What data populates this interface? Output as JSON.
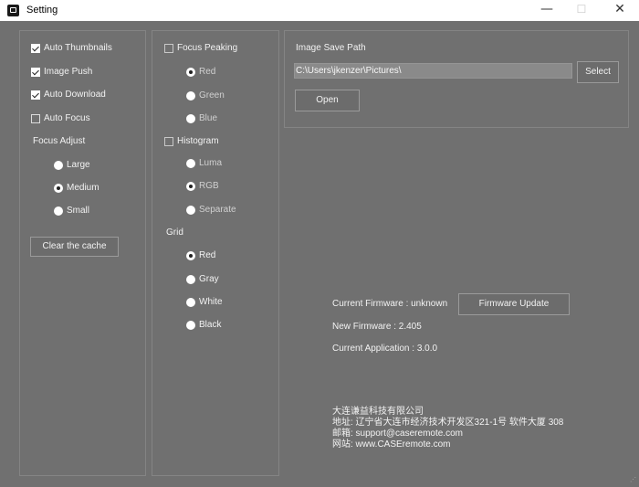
{
  "window": {
    "title": "Setting",
    "minimize_glyph": "—",
    "maximize_glyph": "☐",
    "close_glyph": "✕"
  },
  "left_panel": {
    "options": [
      {
        "label": "Auto Thumbnails",
        "checked": true
      },
      {
        "label": "Image Push",
        "checked": true
      },
      {
        "label": "Auto Download",
        "checked": true
      },
      {
        "label": "Auto Focus",
        "checked": false
      }
    ],
    "focus_adjust": {
      "heading": "Focus Adjust",
      "options": [
        {
          "label": "Large",
          "selected": false
        },
        {
          "label": "Medium",
          "selected": true
        },
        {
          "label": "Small",
          "selected": false
        }
      ]
    },
    "clear_cache_label": "Clear the cache"
  },
  "middle_panel": {
    "focus_peaking": {
      "label": "Focus Peaking",
      "checked": false,
      "options": [
        {
          "label": "Red",
          "selected": true
        },
        {
          "label": "Green",
          "selected": false
        },
        {
          "label": "Blue",
          "selected": false
        }
      ]
    },
    "histogram": {
      "label": "Histogram",
      "checked": false,
      "options": [
        {
          "label": "Luma",
          "selected": false
        },
        {
          "label": "RGB",
          "selected": true
        },
        {
          "label": "Separate",
          "selected": false
        }
      ]
    },
    "grid": {
      "heading": "Grid",
      "options": [
        {
          "label": "Red",
          "selected": true
        },
        {
          "label": "Gray",
          "selected": false
        },
        {
          "label": "White",
          "selected": false
        },
        {
          "label": "Black",
          "selected": false
        }
      ]
    }
  },
  "save_path": {
    "heading": "Image Save Path",
    "value": "C:\\Users\\jkenzer\\Pictures\\",
    "select_label": "Select",
    "open_label": "Open"
  },
  "firmware": {
    "current": "Current Firmware : unknown",
    "update_label": "Firmware Update",
    "new": "New Firmware : 2.405",
    "application": "Current Application : 3.0.0"
  },
  "company": {
    "name": "大连谦益科技有限公司",
    "address": "地址: 辽宁省大连市经济技术开发区321-1号 软件大厦 308",
    "email": "邮箱: support@caseremote.com",
    "website": "网站: www.CASEremote.com"
  },
  "colors": {
    "background": "#707070",
    "titlebar": "#ffffff",
    "text": "#f2f2f2"
  }
}
